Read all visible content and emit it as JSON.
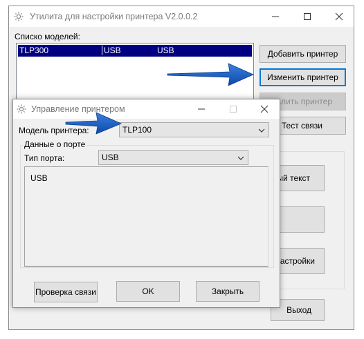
{
  "main_window": {
    "title": "Утилита для настройки принтера  V2.0.0.2",
    "models_label": "Списко моделей:",
    "models": [
      {
        "model": "TLP300",
        "port": "USB",
        "port_value": "USB"
      }
    ],
    "buttons": {
      "add": "Добавить принтер",
      "edit": "Изменить принтер",
      "delete": "алить принтер",
      "test": "Тест связи",
      "text": "ый текст",
      "settings": "астройки",
      "exit": "Выход"
    }
  },
  "dialog": {
    "title": "Управление принтером",
    "model_label": "Модель принтера:",
    "model_value": "TLP100",
    "port_group_label": "Данные о порте",
    "port_type_label": "Тип порта:",
    "port_type_value": "USB",
    "port_detail": "USB",
    "buttons": {
      "check": "Проверка связи",
      "ok": "OK",
      "close": "Закрыть"
    }
  },
  "colors": {
    "selection": "#000080",
    "arrow": "#1e64c8",
    "focus": "#0078d7"
  },
  "icons": [
    "gear-icon",
    "minimize-icon",
    "maximize-icon",
    "close-icon",
    "chevron-down-icon",
    "arrow-pointer"
  ]
}
